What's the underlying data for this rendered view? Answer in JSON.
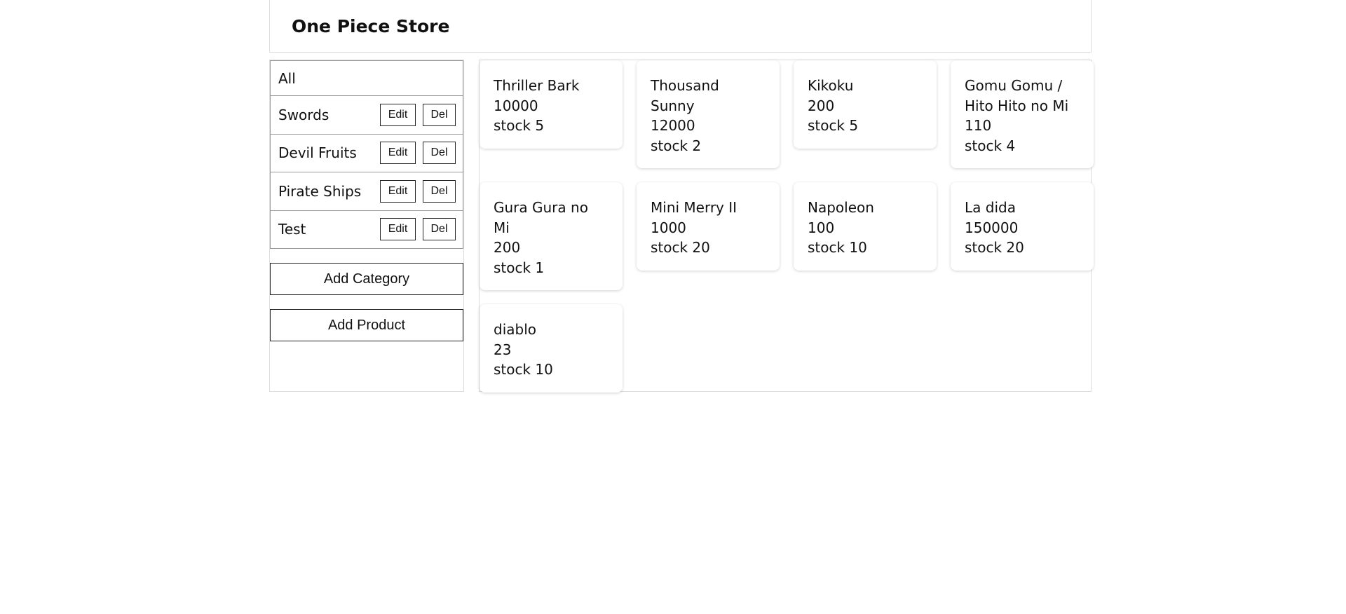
{
  "header": {
    "title": "One Piece Store"
  },
  "sidebar": {
    "all_label": "All",
    "categories": [
      {
        "label": "Swords",
        "edit": "Edit",
        "del": "Del"
      },
      {
        "label": "Devil Fruits",
        "edit": "Edit",
        "del": "Del"
      },
      {
        "label": "Pirate Ships",
        "edit": "Edit",
        "del": "Del"
      },
      {
        "label": "Test",
        "edit": "Edit",
        "del": "Del"
      }
    ],
    "add_category": "Add Category",
    "add_product": "Add Product"
  },
  "products": [
    {
      "name": "Thriller Bark",
      "price": "10000",
      "stock": "stock 5"
    },
    {
      "name": "Thousand Sunny",
      "price": "12000",
      "stock": "stock 2"
    },
    {
      "name": "Kikoku",
      "price": "200",
      "stock": "stock 5"
    },
    {
      "name": "Gomu Gomu / Hito Hito no Mi",
      "price": "110",
      "stock": "stock 4"
    },
    {
      "name": "Gura Gura no Mi",
      "price": "200",
      "stock": "stock 1"
    },
    {
      "name": "Mini Merry II",
      "price": "1000",
      "stock": "stock 20"
    },
    {
      "name": "Napoleon",
      "price": "100",
      "stock": "stock 10"
    },
    {
      "name": "La dida",
      "price": "150000",
      "stock": "stock 20"
    },
    {
      "name": "diablo",
      "price": "23",
      "stock": "stock 10"
    }
  ]
}
